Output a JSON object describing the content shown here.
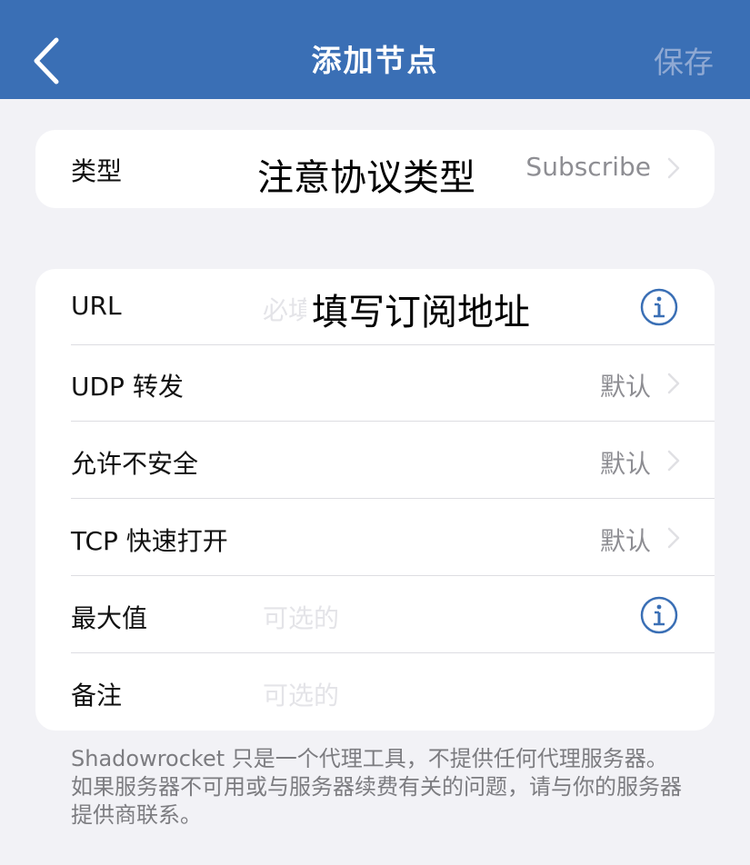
{
  "nav": {
    "title": "添加节点",
    "save_label": "保存"
  },
  "type_row": {
    "label": "类型",
    "value": "Subscribe",
    "overlay": "注意协议类型"
  },
  "rows": [
    {
      "label": "URL",
      "placeholder": "必填",
      "overlay": "填写订阅地址",
      "icon": "info-icon"
    },
    {
      "label": "UDP 转发",
      "value": "默认",
      "icon": "chevron-right-icon"
    },
    {
      "label": "允许不安全",
      "value": "默认",
      "icon": "chevron-right-icon"
    },
    {
      "label": "TCP 快速打开",
      "value": "默认",
      "icon": "chevron-right-icon"
    },
    {
      "label": "最大值",
      "placeholder": "可选的",
      "icon": "info-icon"
    },
    {
      "label": "备注",
      "placeholder": "可选的"
    }
  ],
  "footer": "Shadowrocket 只是一个代理工具，不提供任何代理服务器。如果服务器不可用或与服务器续费有关的问题，请与你的服务器提供商联系。",
  "colors": {
    "nav_bg": "#3a6fb5",
    "accent": "#3a6fb5",
    "background": "#f2f2f6"
  }
}
